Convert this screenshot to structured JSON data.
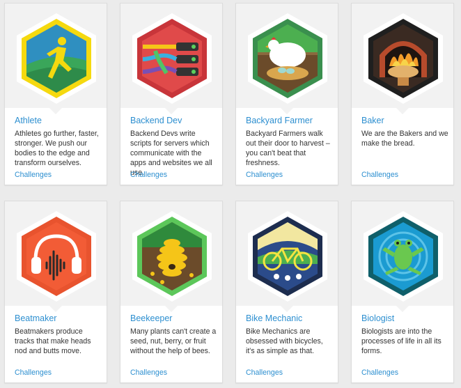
{
  "cards": [
    {
      "title": "Athlete",
      "description": "Athletes go further, faster, stronger. We push our bodies to the edge and transform ourselves.",
      "link": "Challenges",
      "badge_icon": "runner-icon",
      "colors": {
        "border": "#f5d90f",
        "fill": "#2f8fc0"
      }
    },
    {
      "title": "Backend Dev",
      "description": "Backend Devs write scripts for servers which communicate with the apps and websites we all use.",
      "link": "Challenges",
      "badge_icon": "server-cables-icon",
      "colors": {
        "border": "#e9474a",
        "fill": "#e04a4a"
      }
    },
    {
      "title": "Backyard Farmer",
      "description": "Backyard Farmers walk out their door to harvest – you can't beat that freshness.",
      "link": "Challenges",
      "badge_icon": "hen-nest-icon",
      "colors": {
        "border": "#3fae6e",
        "fill": "#4caf50"
      }
    },
    {
      "title": "Baker",
      "description": "We are the Bakers and we make the bread.",
      "link": "Challenges",
      "badge_icon": "bread-oven-icon",
      "colors": {
        "border": "#1f1f1f",
        "fill": "#e07a2c"
      }
    },
    {
      "title": "Beatmaker",
      "description": "Beatmakers produce tracks that make heads nod and butts move.",
      "link": "Challenges",
      "badge_icon": "headphones-icon",
      "colors": {
        "border": "#f06a3a",
        "fill": "#f25c36"
      }
    },
    {
      "title": "Beekeeper",
      "description": "Many plants can't create a seed, nut, berry, or fruit without the help of bees.",
      "link": "Challenges",
      "badge_icon": "beehive-icon",
      "colors": {
        "border": "#5cc75a",
        "fill": "#6b4b2a"
      }
    },
    {
      "title": "Bike Mechanic",
      "description": "Bike Mechanics are obsessed with bicycles, it's as simple as that.",
      "link": "Challenges",
      "badge_icon": "bicycle-icon",
      "colors": {
        "border": "#1d2d4f",
        "fill": "#2b4b8a"
      }
    },
    {
      "title": "Biologist",
      "description": "Biologists are into the processes of life in all its forms.",
      "link": "Challenges",
      "badge_icon": "frog-icon",
      "colors": {
        "border": "#0f5f6a",
        "fill": "#1b9bd1"
      }
    }
  ]
}
